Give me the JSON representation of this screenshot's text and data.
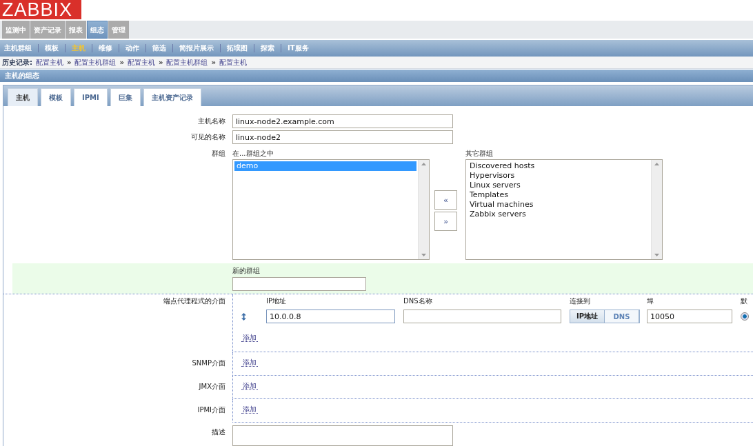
{
  "logo": "ZABBIX",
  "main_menu": [
    {
      "label": "监测中",
      "selected": false
    },
    {
      "label": "资产记录",
      "selected": false
    },
    {
      "label": "报表",
      "selected": false
    },
    {
      "label": "组态",
      "selected": true
    },
    {
      "label": "管理",
      "selected": false
    }
  ],
  "sub_menu": [
    {
      "label": "主机群组",
      "selected": false
    },
    {
      "label": "模板",
      "selected": false
    },
    {
      "label": "主机",
      "selected": true
    },
    {
      "label": "维修",
      "selected": false
    },
    {
      "label": "动作",
      "selected": false
    },
    {
      "label": "筛选",
      "selected": false
    },
    {
      "label": "简报片展示",
      "selected": false
    },
    {
      "label": "拓墣图",
      "selected": false
    },
    {
      "label": "探索",
      "selected": false
    },
    {
      "label": "IT服务",
      "selected": false
    }
  ],
  "breadcrumb": [
    {
      "kind": "title",
      "text": "历史记录:"
    },
    {
      "kind": "link",
      "text": "配置主机"
    },
    {
      "kind": "sep",
      "text": "»"
    },
    {
      "kind": "link",
      "text": "配置主机群组"
    },
    {
      "kind": "sep",
      "text": "»"
    },
    {
      "kind": "link",
      "text": "配置主机"
    },
    {
      "kind": "sep",
      "text": "»"
    },
    {
      "kind": "link",
      "text": "配置主机群组"
    },
    {
      "kind": "sep",
      "text": "»"
    },
    {
      "kind": "link",
      "text": "配置主机"
    }
  ],
  "section_title": "主机的组态",
  "tabs": [
    {
      "label": "主机",
      "selected": true
    },
    {
      "label": "模板",
      "selected": false
    },
    {
      "label": "IPMI",
      "selected": false
    },
    {
      "label": "巨集",
      "selected": false
    },
    {
      "label": "主机资产记录",
      "selected": false
    }
  ],
  "host_name": {
    "label": "主机名称",
    "value": "linux-node2.example.com"
  },
  "visible_name": {
    "label": "可见的名称",
    "value": "linux-node2"
  },
  "groups": {
    "label": "群组",
    "in_label": "在...群组之中",
    "in_groups": [
      {
        "name": "demo",
        "selected": true
      }
    ],
    "other_label": "其它群组",
    "other_groups": [
      {
        "name": "Discovered hosts",
        "selected": false
      },
      {
        "name": "Hypervisors",
        "selected": false
      },
      {
        "name": "Linux servers",
        "selected": false
      },
      {
        "name": "Templates",
        "selected": false
      },
      {
        "name": "Virtual machines",
        "selected": false
      },
      {
        "name": "Zabbix servers",
        "selected": false
      }
    ],
    "add_button": "«",
    "remove_button": "»"
  },
  "new_group": {
    "label": "新的群组"
  },
  "agent_interfaces": {
    "label": "端点代理程式的介面",
    "headers": [
      "IP地址",
      "DNS名称",
      "连接到",
      "埠",
      "默"
    ],
    "interfaces": [
      {
        "ip": "10.0.0.8",
        "connect": [
          {
            "label": "IP地址",
            "selected": true
          },
          {
            "label": "DNS",
            "selected": false
          }
        ],
        "port": "10050",
        "default": true
      }
    ],
    "add": "添加"
  },
  "other_interfaces": [
    {
      "label": "SNMP介面",
      "add": "添加"
    },
    {
      "label": "JMX介面",
      "add": "添加"
    },
    {
      "label": "IPMI介面",
      "add": "添加"
    }
  ],
  "description": {
    "label": "描述"
  }
}
